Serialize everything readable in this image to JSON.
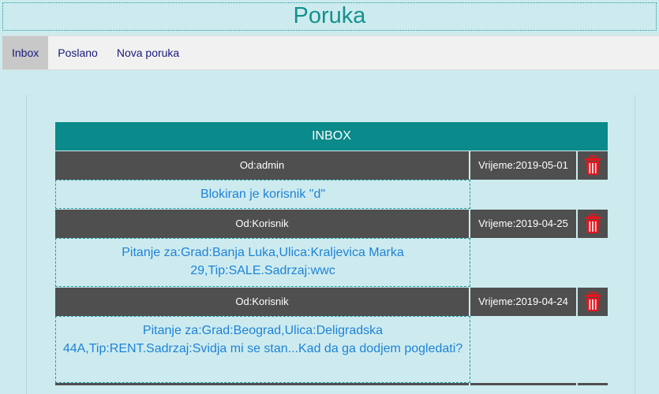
{
  "header": {
    "title": "Poruka"
  },
  "nav": {
    "items": [
      {
        "label": "Inbox",
        "active": true
      },
      {
        "label": "Poslano",
        "active": false
      },
      {
        "label": "Nova poruka",
        "active": false
      }
    ]
  },
  "inbox": {
    "title": "INBOX",
    "messages": [
      {
        "from": "Od:admin",
        "time": "Vrijeme:2019-05-01",
        "body": "Blokiran je korisnik \"d\""
      },
      {
        "from": "Od:Korisnik",
        "time": "Vrijeme:2019-04-25",
        "body": "Pitanje za:Grad:Banja Luka,Ulica:Kraljevica Marka 29,Tip:SALE.Sadrzaj:wwc"
      },
      {
        "from": "Od:Korisnik",
        "time": "Vrijeme:2019-04-24",
        "body": "Pitanje za:Grad:Beograd,Ulica:Deligradska 44A,Tip:RENT.Sadrzaj:Svidja mi se stan...Kad da ga dodjem pogledati?"
      }
    ]
  },
  "colors": {
    "header_text": "#14918f",
    "inbox_header_bg": "#0a8a8a",
    "row_header_bg": "#4f4f4f",
    "message_text": "#1e82d8",
    "trash_icon": "#e8141c"
  },
  "icons": {
    "delete": "trash-icon"
  }
}
